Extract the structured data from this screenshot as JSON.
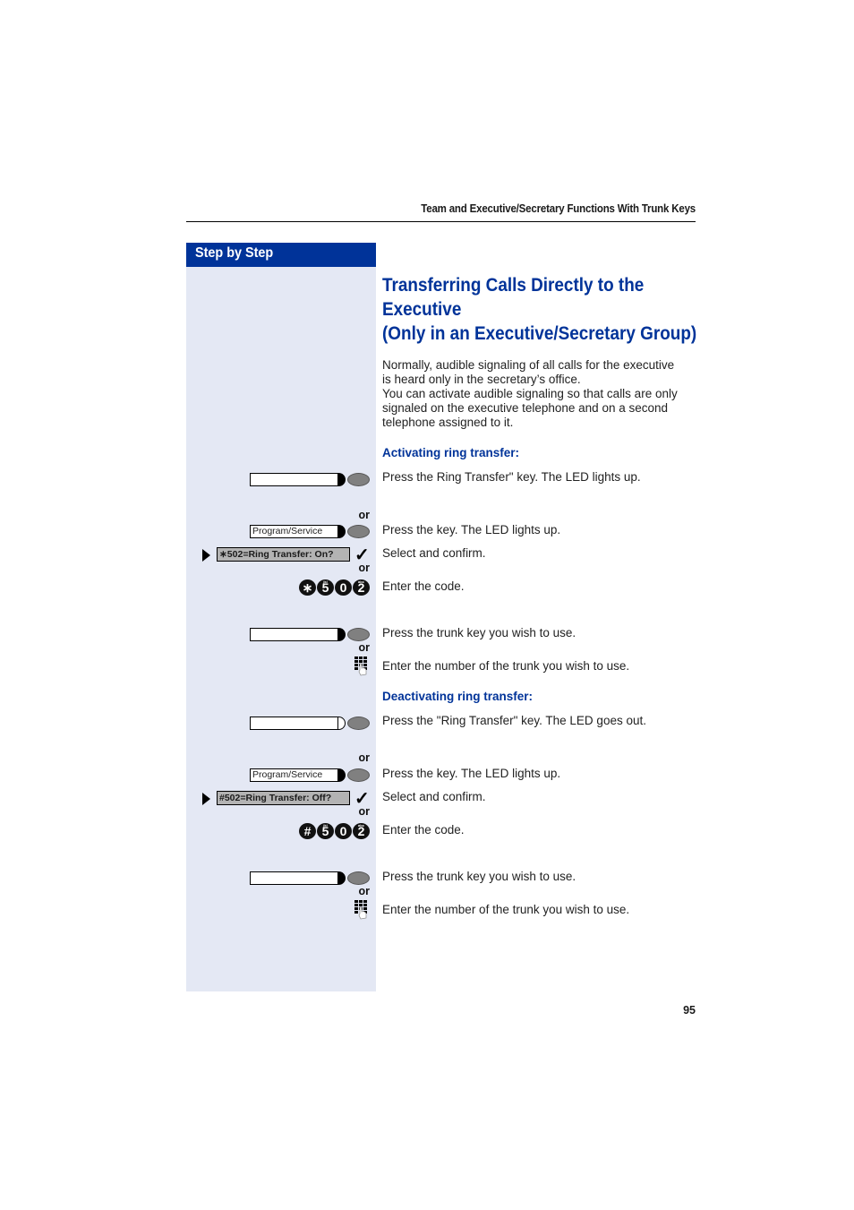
{
  "header": {
    "title": "Team and Executive/Secretary Functions With Trunk Keys"
  },
  "sidebar": {
    "heading": "Step by Step"
  },
  "main": {
    "title_lines": [
      "Transferring Calls Directly to the",
      "Executive",
      "(Only in an Executive/Secretary Group)"
    ],
    "intro_lines": [
      "Normally, audible signaling of all calls for the executive",
      "is heard only in the secretary’s office.",
      "You can activate audible signaling so that calls are only",
      "signaled on the executive telephone and on a second",
      "telephone assigned to it."
    ],
    "activating": {
      "heading": "Activating ring transfer:",
      "steps": [
        {
          "text": "Press the Ring Transfer\" key. The LED lights up.",
          "key_label": "",
          "led": "on"
        },
        {
          "or": "or"
        },
        {
          "text": "Press the key. The LED lights up.",
          "key_label": "Program/Service",
          "led": "on"
        },
        {
          "text": "Select and confirm.",
          "menu_label": "∗502=Ring Transfer: On?",
          "confirm_icon": "✓"
        },
        {
          "or": "or"
        },
        {
          "text": "Enter the code.",
          "code_keys": [
            {
              "main": "∗",
              "sub": ""
            },
            {
              "main": "5",
              "sub": "jkl"
            },
            {
              "main": "0",
              "sub": ""
            },
            {
              "main": "2",
              "sub": "abc"
            }
          ]
        },
        {
          "text": "Press the trunk key you wish to use.",
          "key_label": "",
          "led": "on"
        },
        {
          "or": "or"
        },
        {
          "text": "Enter the number of the trunk you wish to use."
        }
      ]
    },
    "deactivating": {
      "heading": "Deactivating ring transfer:",
      "steps": [
        {
          "text": "Press the \"Ring Transfer\" key. The LED goes out.",
          "key_label": "",
          "led": "off"
        },
        {
          "or": "or"
        },
        {
          "text": "Press the key. The LED lights up.",
          "key_label": "Program/Service",
          "led": "on"
        },
        {
          "text": "Select and confirm.",
          "menu_label": "#502=Ring Transfer: Off?",
          "confirm_icon": "✓"
        },
        {
          "or": "or"
        },
        {
          "text": "Enter the code.",
          "code_keys": [
            {
              "main": "#",
              "sub": ""
            },
            {
              "main": "5",
              "sub": "jkl"
            },
            {
              "main": "0",
              "sub": ""
            },
            {
              "main": "2",
              "sub": "abc"
            }
          ]
        },
        {
          "text": "Press the trunk key you wish to use.",
          "key_label": "",
          "led": "on"
        },
        {
          "or": "or"
        },
        {
          "text": "Enter the number of the trunk you wish to use."
        }
      ]
    }
  },
  "footer": {
    "page_number": "95"
  }
}
